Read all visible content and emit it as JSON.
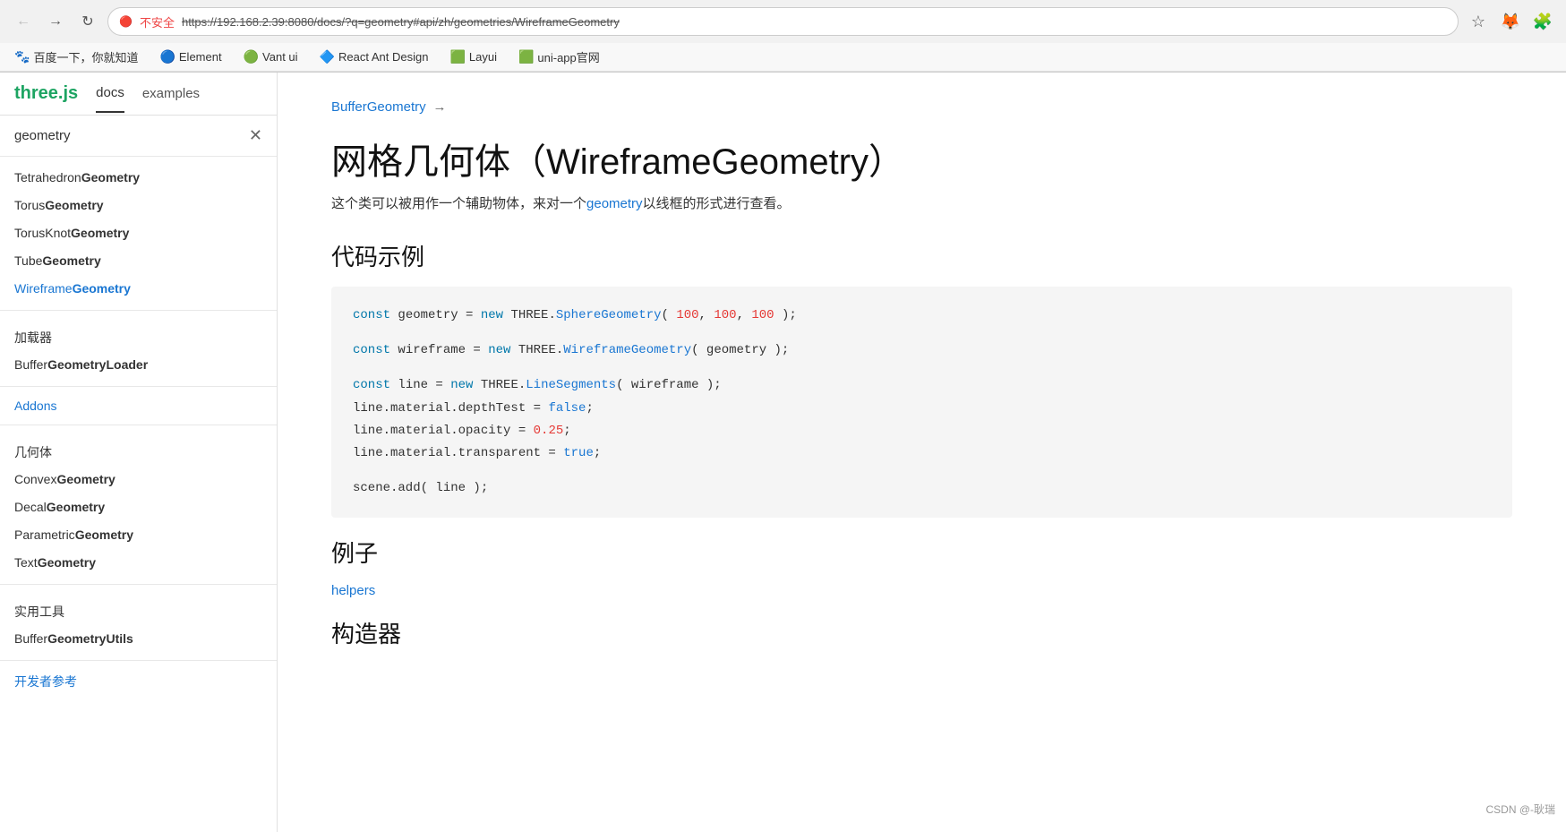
{
  "browser": {
    "url": "https://192.168.2.39:8080/docs/?q=geometry#api/zh/geometries/WireframeGeometry",
    "lock_label": "不安全",
    "back_disabled": false,
    "forward_disabled": false
  },
  "bookmarks": [
    {
      "id": "baidu",
      "icon": "🐾",
      "label": "百度一下，你就知道"
    },
    {
      "id": "element",
      "icon": "🔵",
      "label": "Element"
    },
    {
      "id": "vant",
      "icon": "🟢",
      "label": "Vant ui"
    },
    {
      "id": "react-ant",
      "icon": "🔷",
      "label": "React Ant Design"
    },
    {
      "id": "layui",
      "icon": "🟩",
      "label": "Layui"
    },
    {
      "id": "uniapp",
      "icon": "🟩",
      "label": "uni-app官网"
    }
  ],
  "sidebar": {
    "brand": "three.js",
    "tabs": [
      {
        "id": "docs",
        "label": "docs",
        "active": true
      },
      {
        "id": "examples",
        "label": "examples",
        "active": false
      }
    ],
    "search_label": "geometry",
    "items": [
      {
        "id": "tetrahedron",
        "label_plain": "Tetrahedron",
        "label_bold": "Geometry",
        "active": false
      },
      {
        "id": "torus",
        "label_plain": "Torus",
        "label_bold": "Geometry",
        "active": false
      },
      {
        "id": "torusknot",
        "label_plain": "TorusKnot",
        "label_bold": "Geometry",
        "active": false
      },
      {
        "id": "tube",
        "label_plain": "Tube",
        "label_bold": "Geometry",
        "active": false
      },
      {
        "id": "wireframe",
        "label_plain": "Wireframe",
        "label_bold": "Geometry",
        "active": true
      }
    ],
    "section_loaders": {
      "header": "加载器",
      "items": [
        {
          "id": "buffer-loader",
          "label_plain": "Buffer",
          "label_bold": "GeometryLoader"
        }
      ]
    },
    "section_addons": {
      "header": "Addons"
    },
    "section_geometry2": {
      "header": "几何体",
      "items": [
        {
          "id": "convex",
          "label_plain": "Convex",
          "label_bold": "Geometry"
        },
        {
          "id": "decal",
          "label_plain": "Decal",
          "label_bold": "Geometry"
        },
        {
          "id": "parametric",
          "label_plain": "Parametric",
          "label_bold": "Geometry"
        },
        {
          "id": "text",
          "label_plain": "Text",
          "label_bold": "Geometry"
        }
      ]
    },
    "section_utils": {
      "header": "实用工具",
      "items": [
        {
          "id": "buffer-utils",
          "label_plain": "Buffer",
          "label_bold": "GeometryUtils"
        }
      ]
    },
    "section_dev": {
      "header": "开发者参考"
    }
  },
  "main": {
    "breadcrumb_text": "BufferGeometry",
    "breadcrumb_arrow": "→",
    "page_title": "网格几何体（WireframeGeometry）",
    "page_subtitle_before": "这个类可以被用作一个辅助物体，来对一个",
    "page_subtitle_link": "geometry",
    "page_subtitle_after": "以线框的形式进行查看。",
    "section_code_title": "代码示例",
    "code_lines": [
      {
        "id": "line1",
        "parts": [
          {
            "type": "keyword",
            "text": "const "
          },
          {
            "type": "plain",
            "text": "geometry = "
          },
          {
            "type": "keyword",
            "text": "new "
          },
          {
            "type": "plain",
            "text": "THREE."
          },
          {
            "type": "class",
            "text": "SphereGeometry"
          },
          {
            "type": "plain",
            "text": "( "
          },
          {
            "type": "number",
            "text": "100"
          },
          {
            "type": "plain",
            "text": ", "
          },
          {
            "type": "number",
            "text": "100"
          },
          {
            "type": "plain",
            "text": ", "
          },
          {
            "type": "number",
            "text": "100"
          },
          {
            "type": "plain",
            "text": " );"
          }
        ]
      },
      {
        "id": "empty1",
        "parts": []
      },
      {
        "id": "line2",
        "parts": [
          {
            "type": "keyword",
            "text": "const "
          },
          {
            "type": "plain",
            "text": "wireframe = "
          },
          {
            "type": "keyword",
            "text": "new "
          },
          {
            "type": "plain",
            "text": "THREE."
          },
          {
            "type": "class",
            "text": "WireframeGeometry"
          },
          {
            "type": "plain",
            "text": "( geometry );"
          }
        ]
      },
      {
        "id": "empty2",
        "parts": []
      },
      {
        "id": "line3",
        "parts": [
          {
            "type": "keyword",
            "text": "const "
          },
          {
            "type": "plain",
            "text": "line = "
          },
          {
            "type": "keyword",
            "text": "new "
          },
          {
            "type": "plain",
            "text": "THREE."
          },
          {
            "type": "class",
            "text": "LineSegments"
          },
          {
            "type": "plain",
            "text": "( wireframe );"
          }
        ]
      },
      {
        "id": "line4",
        "parts": [
          {
            "type": "plain",
            "text": "line.material.depthTest = "
          },
          {
            "type": "bool",
            "text": "false"
          },
          {
            "type": "plain",
            "text": ";"
          }
        ]
      },
      {
        "id": "line5",
        "parts": [
          {
            "type": "plain",
            "text": "line.material.opacity = "
          },
          {
            "type": "number",
            "text": "0.25"
          },
          {
            "type": "plain",
            "text": ";"
          }
        ]
      },
      {
        "id": "line6",
        "parts": [
          {
            "type": "plain",
            "text": "line.material.transparent = "
          },
          {
            "type": "bool",
            "text": "true"
          },
          {
            "type": "plain",
            "text": ";"
          }
        ]
      },
      {
        "id": "empty3",
        "parts": []
      },
      {
        "id": "line7",
        "parts": [
          {
            "type": "plain",
            "text": "scene.add( line );"
          }
        ]
      }
    ],
    "section_examples_title": "例子",
    "examples_link": "helpers",
    "section_constructor_title": "构造器"
  },
  "footer": {
    "credit": "CSDN @-耿瑞"
  }
}
